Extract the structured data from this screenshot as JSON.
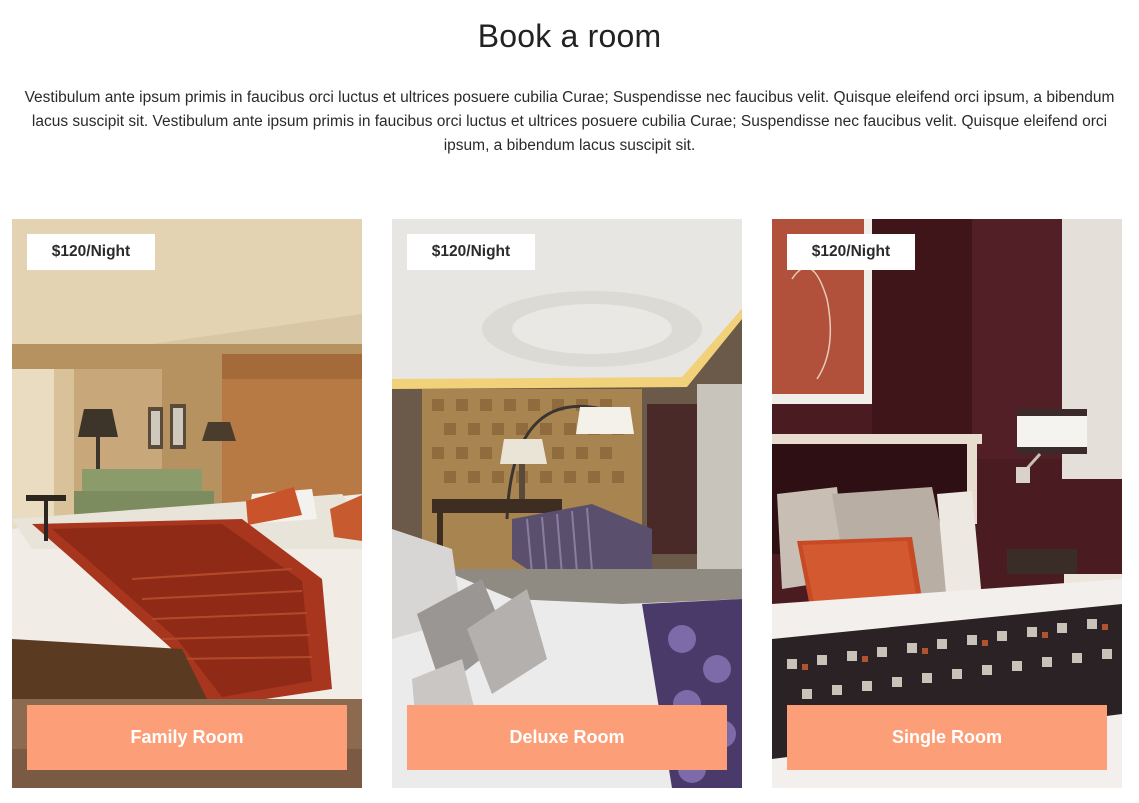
{
  "section": {
    "title": "Book a room",
    "description": "Vestibulum ante ipsum primis in faucibus orci luctus et ultrices posuere cubilia Curae; Suspendisse nec faucibus velit. Quisque eleifend orci ipsum, a bibendum lacus suscipit sit. Vestibulum ante ipsum primis in faucibus orci luctus et ultrices posuere cubilia Curae; Suspendisse nec faucibus velit. Quisque eleifend orci ipsum, a bibendum lacus suscipit sit."
  },
  "rooms": [
    {
      "name": "Family Room",
      "price": "$120/Night",
      "image": "hotel-room-photo"
    },
    {
      "name": "Deluxe Room",
      "price": "$120/Night",
      "image": "hotel-suite-photo"
    },
    {
      "name": "Single Room",
      "price": "$120/Night",
      "image": "hotel-bed-closeup-photo"
    }
  ],
  "colors": {
    "accent": "#fc9f78",
    "heading": "#222222",
    "price_tag_bg": "#ffffff"
  }
}
